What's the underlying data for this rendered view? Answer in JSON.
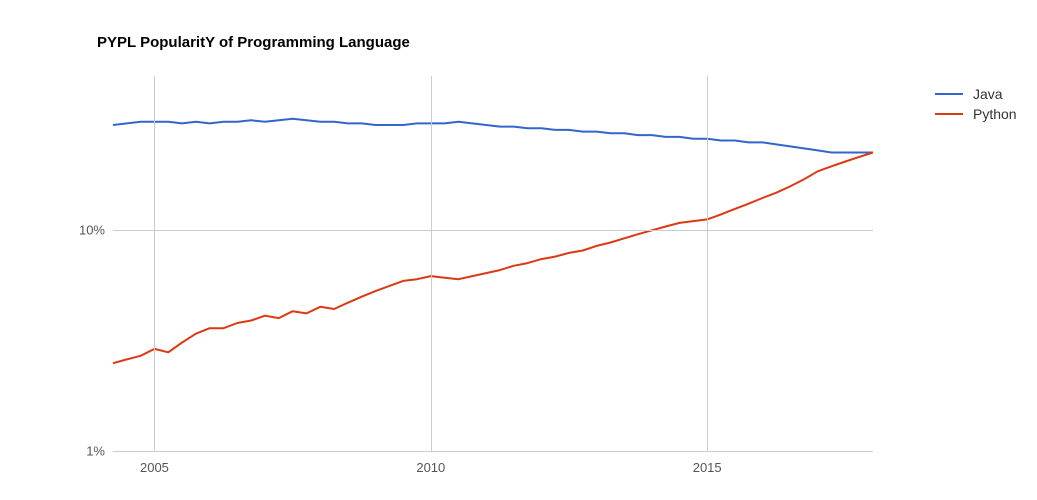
{
  "chart_data": {
    "type": "line",
    "title": "PYPL PopularitY of Programming Language",
    "xlabel": "",
    "ylabel": "",
    "yscale": "log",
    "ylim": [
      1,
      50
    ],
    "y_ticks": [
      1,
      10
    ],
    "y_tick_labels": [
      "1%",
      "10%"
    ],
    "x_ticks": [
      2005,
      2010,
      2015
    ],
    "x_tick_labels": [
      "2005",
      "2010",
      "2015"
    ],
    "xrange": [
      2004.25,
      2018.0
    ],
    "series": [
      {
        "name": "Java",
        "color": "#3366cc",
        "x": [
          2004.25,
          2004.5,
          2004.75,
          2005.0,
          2005.25,
          2005.5,
          2005.75,
          2006.0,
          2006.25,
          2006.5,
          2006.75,
          2007.0,
          2007.25,
          2007.5,
          2007.75,
          2008.0,
          2008.25,
          2008.5,
          2008.75,
          2009.0,
          2009.25,
          2009.5,
          2009.75,
          2010.0,
          2010.25,
          2010.5,
          2010.75,
          2011.0,
          2011.25,
          2011.5,
          2011.75,
          2012.0,
          2012.25,
          2012.5,
          2012.75,
          2013.0,
          2013.25,
          2013.5,
          2013.75,
          2014.0,
          2014.25,
          2014.5,
          2014.75,
          2015.0,
          2015.25,
          2015.5,
          2015.75,
          2016.0,
          2016.25,
          2016.5,
          2016.75,
          2017.0,
          2017.25,
          2017.5,
          2017.75,
          2018.0
        ],
        "values": [
          30.0,
          30.5,
          31.0,
          31.0,
          31.0,
          30.5,
          31.0,
          30.5,
          31.0,
          31.0,
          31.5,
          31.0,
          31.5,
          32.0,
          31.5,
          31.0,
          31.0,
          30.5,
          30.5,
          30.0,
          30.0,
          30.0,
          30.5,
          30.5,
          30.5,
          31.0,
          30.5,
          30.0,
          29.5,
          29.5,
          29.0,
          29.0,
          28.5,
          28.5,
          28.0,
          28.0,
          27.5,
          27.5,
          27.0,
          27.0,
          26.5,
          26.5,
          26.0,
          26.0,
          25.5,
          25.5,
          25.0,
          25.0,
          24.5,
          24.0,
          23.5,
          23.0,
          22.5,
          22.5,
          22.5,
          22.5
        ]
      },
      {
        "name": "Python",
        "color": "#dc3912",
        "x": [
          2004.25,
          2004.5,
          2004.75,
          2005.0,
          2005.25,
          2005.5,
          2005.75,
          2006.0,
          2006.25,
          2006.5,
          2006.75,
          2007.0,
          2007.25,
          2007.5,
          2007.75,
          2008.0,
          2008.25,
          2008.5,
          2008.75,
          2009.0,
          2009.25,
          2009.5,
          2009.75,
          2010.0,
          2010.25,
          2010.5,
          2010.75,
          2011.0,
          2011.25,
          2011.5,
          2011.75,
          2012.0,
          2012.25,
          2012.5,
          2012.75,
          2013.0,
          2013.25,
          2013.5,
          2013.75,
          2014.0,
          2014.25,
          2014.5,
          2014.75,
          2015.0,
          2015.25,
          2015.5,
          2015.75,
          2016.0,
          2016.25,
          2016.5,
          2016.75,
          2017.0,
          2017.25,
          2017.5,
          2017.75,
          2018.0
        ],
        "values": [
          2.5,
          2.6,
          2.7,
          2.9,
          2.8,
          3.1,
          3.4,
          3.6,
          3.6,
          3.8,
          3.9,
          4.1,
          4.0,
          4.3,
          4.2,
          4.5,
          4.4,
          4.7,
          5.0,
          5.3,
          5.6,
          5.9,
          6.0,
          6.2,
          6.1,
          6.0,
          6.2,
          6.4,
          6.6,
          6.9,
          7.1,
          7.4,
          7.6,
          7.9,
          8.1,
          8.5,
          8.8,
          9.2,
          9.6,
          10.0,
          10.4,
          10.8,
          11.0,
          11.2,
          11.8,
          12.5,
          13.2,
          14.0,
          14.8,
          15.8,
          17.0,
          18.5,
          19.5,
          20.5,
          21.5,
          22.5
        ]
      }
    ],
    "legend": {
      "position": "right"
    }
  }
}
